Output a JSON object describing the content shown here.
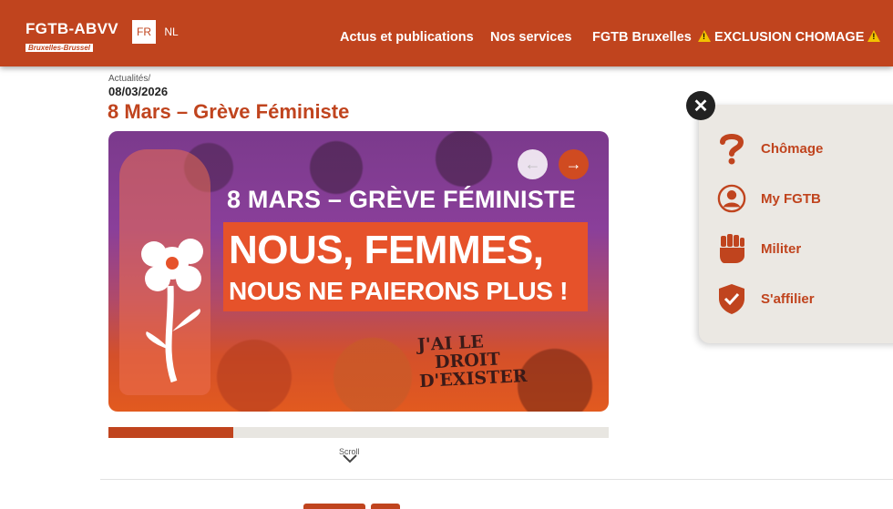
{
  "header": {
    "logo_main": "FGTB-ABVV",
    "logo_sub": "Bruxelles-Brussel",
    "lang_fr": "FR",
    "lang_nl": "NL",
    "nav": [
      "Actus et publications",
      "Nos services",
      "FGTB Bruxelles",
      "EXCLUSION CHOMAGE"
    ],
    "nav_warning_icon": "warning-icon"
  },
  "article": {
    "breadcrumb": "Actualités/",
    "date": "08/03/2026",
    "title": "8 Mars – Grève Féministe"
  },
  "slide": {
    "line1": "8 MARS – GRÈVE FÉMINISTE",
    "line2": "NOUS, FEMMES,",
    "line3": "NOUS NE PAIERONS PLUS !",
    "sign": [
      "J'AI LE",
      "DROIT",
      "D'EXISTER"
    ],
    "prev_icon": "arrow-left-icon",
    "next_icon": "arrow-right-icon",
    "progress": 0.25
  },
  "scroll": {
    "label": "Scroll"
  },
  "side_menu": {
    "close_icon": "close-icon",
    "items": [
      {
        "label": "Chômage",
        "icon": "question-icon"
      },
      {
        "label": "My FGTB",
        "icon": "user-icon"
      },
      {
        "label": "Militer",
        "icon": "fist-icon"
      },
      {
        "label": "S'affilier",
        "icon": "shield-check-icon"
      }
    ]
  },
  "colors": {
    "brand": "#c0441e",
    "panel": "#ebe8e3",
    "warning": "#f2c200"
  }
}
